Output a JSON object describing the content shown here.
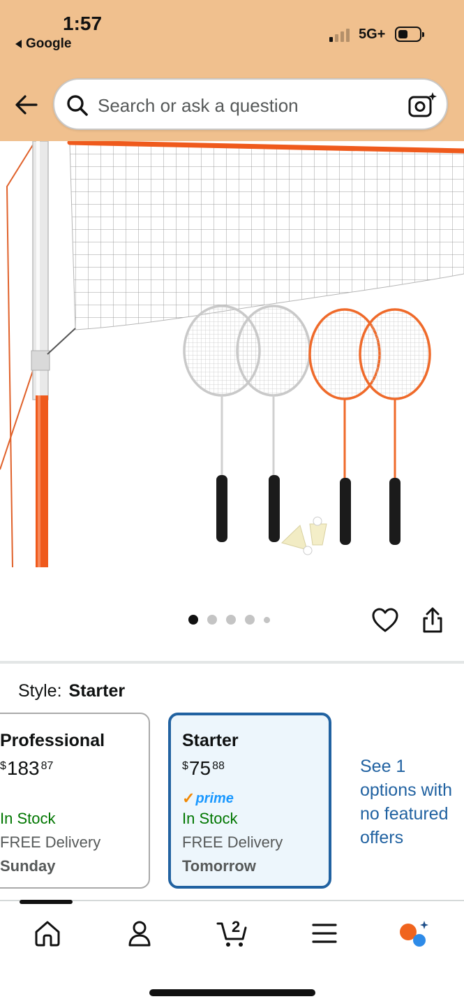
{
  "status_bar": {
    "time": "1:57",
    "back_app": "Google",
    "network": "5G+"
  },
  "search": {
    "placeholder": "Search or ask a question"
  },
  "carousel": {
    "image_count": 5,
    "active_index": 0
  },
  "style_selector": {
    "label": "Style:",
    "selected": "Starter",
    "options": [
      {
        "name": "Professional",
        "price_symbol": "$",
        "price_whole": "183",
        "price_cents": "87",
        "stock": "In Stock",
        "delivery": "FREE Delivery",
        "delivery_date": "Sunday"
      },
      {
        "name": "Starter",
        "price_symbol": "$",
        "price_whole": "75",
        "price_cents": "88",
        "prime": "prime",
        "stock": "In Stock",
        "delivery": "FREE Delivery",
        "delivery_date": "Tomorrow"
      }
    ],
    "see_more": "See 1 options with no featured offers",
    "see_more_lines": [
      "See 1",
      "options with",
      "no featured",
      "offers"
    ]
  },
  "bottom_nav": {
    "cart_count": "2",
    "items": [
      "home-icon",
      "account-icon",
      "cart-icon",
      "menu-icon",
      "rufus-icon"
    ]
  },
  "colors": {
    "header_bg": "#f0c08e",
    "link": "#2162a1",
    "in_stock": "#007600",
    "prime_blue": "#1a98ff",
    "prime_check": "#f08804",
    "selected_card_bg": "#edf6fc",
    "net_orange": "#ef5a1c"
  }
}
